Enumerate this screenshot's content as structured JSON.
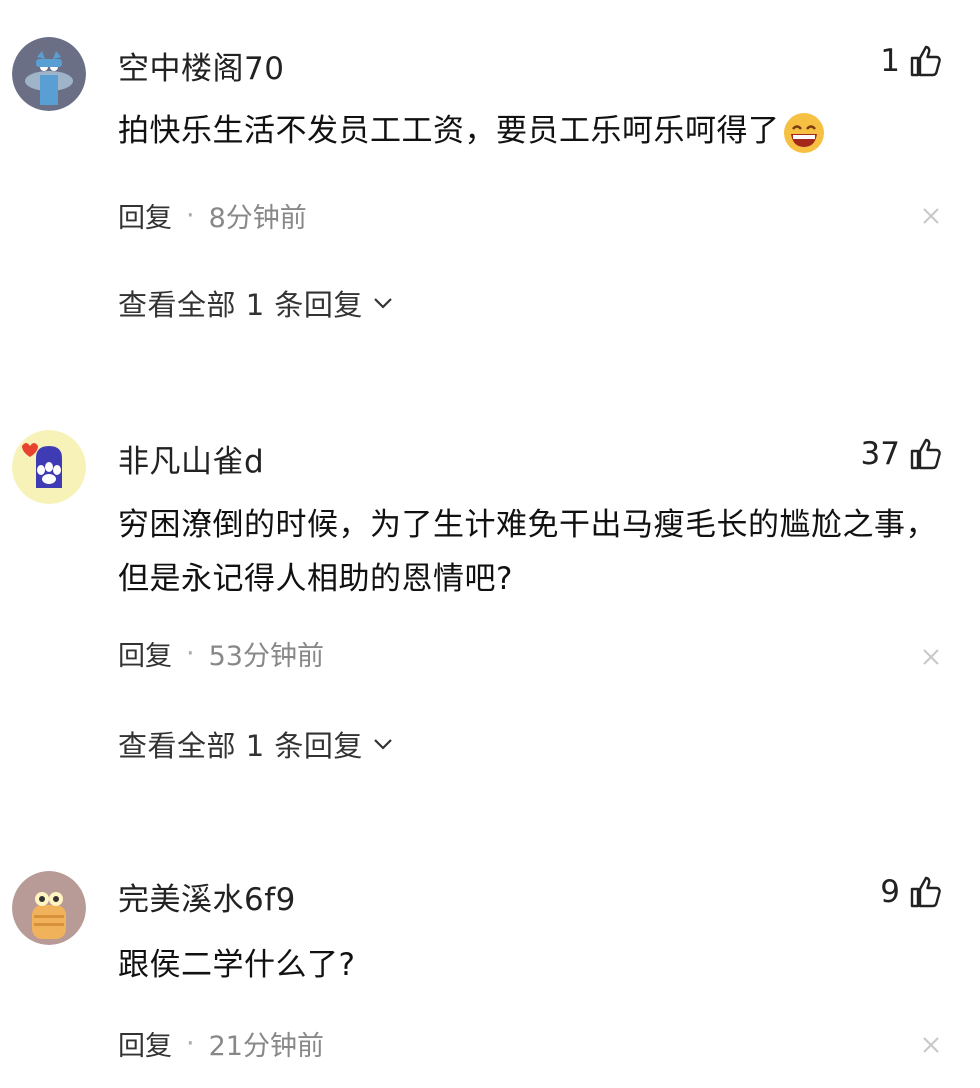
{
  "comments": [
    {
      "username": "空中楼阁70",
      "likes": "1",
      "text": "拍快乐生活不发员工工资，要员工乐呵乐呵得了",
      "reply_label": "回复",
      "separator": "·",
      "time": "8分钟前",
      "view_all": "查看全部 1 条回复",
      "avatar_icon": "blue-creature-avatar"
    },
    {
      "username": "非凡山雀d",
      "likes": "37",
      "text": "穷困潦倒的时候，为了生计难免干出马瘦毛长的尴尬之事，但是永记得人相助的恩情吧?",
      "reply_label": "回复",
      "separator": "·",
      "time": "53分钟前",
      "view_all": "查看全部 1 条回复",
      "avatar_icon": "cat-paw-avatar"
    },
    {
      "username": "完美溪水6f9",
      "likes": "9",
      "text": "跟侯二学什么了?",
      "reply_label": "回复",
      "separator": "·",
      "time": "21分钟前",
      "avatar_icon": "cartoon-character-avatar"
    }
  ],
  "colors": {
    "meta": "#888888",
    "text": "#111111",
    "background": "#ffffff"
  }
}
